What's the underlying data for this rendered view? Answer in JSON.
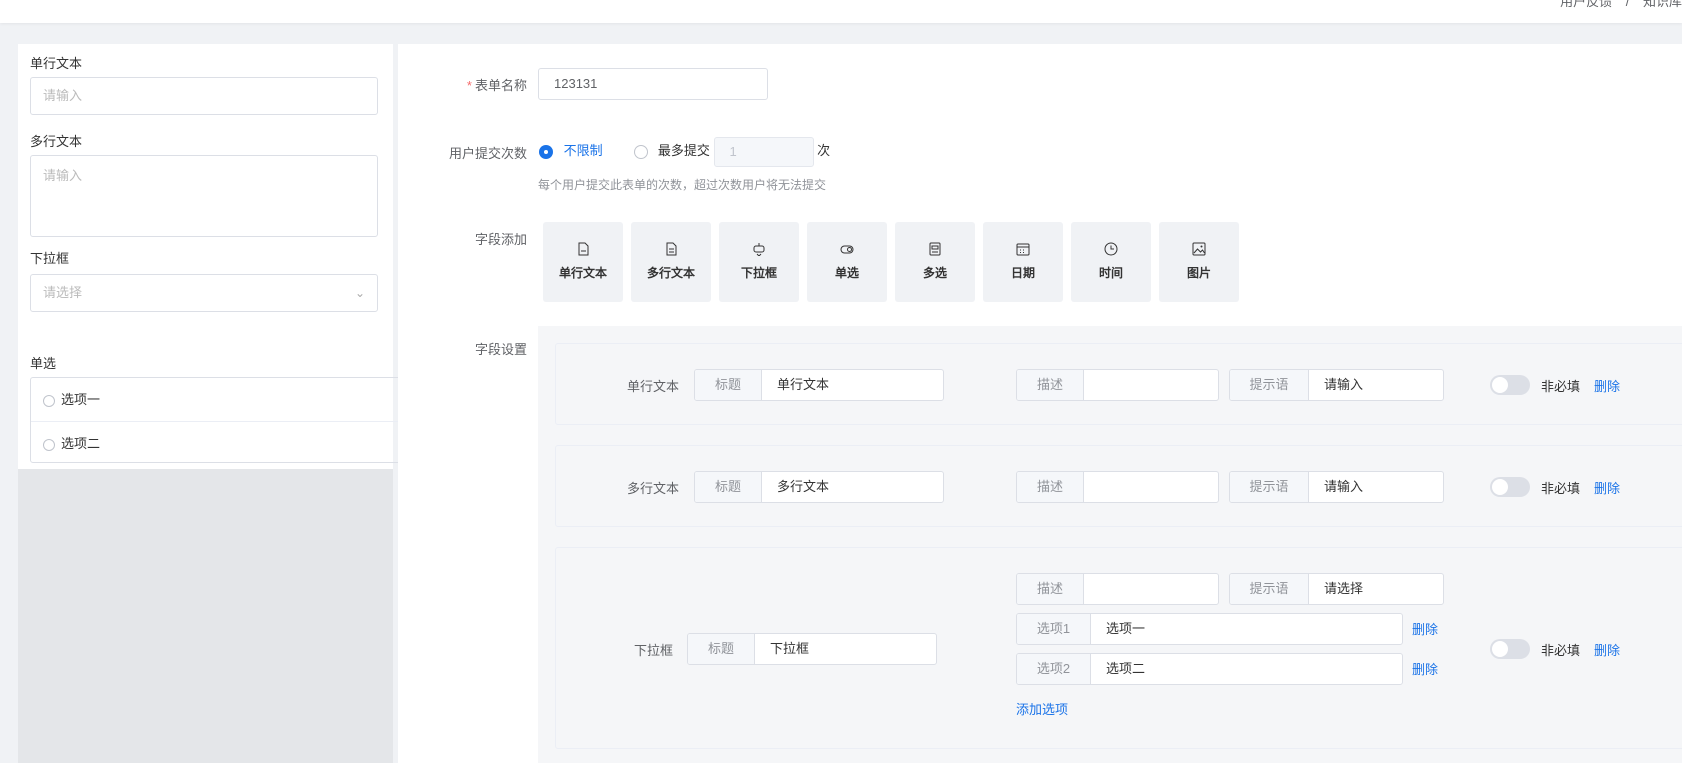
{
  "breadcrumb": [
    "用户反馈",
    "知识库"
  ],
  "preview": {
    "single_label": "单行文本",
    "single_placeholder": "请输入",
    "multi_label": "多行文本",
    "multi_placeholder": "请输入",
    "select_label": "下拉框",
    "select_placeholder": "请选择",
    "radio_label": "单选",
    "radio_options": [
      "选项一",
      "选项二"
    ]
  },
  "form": {
    "name_label": "表单名称",
    "name_value": "123131",
    "submit_label": "用户提交次数",
    "unlimited": "不限制",
    "max_submit": "最多提交",
    "max_value": "1",
    "times_unit": "次",
    "hint": "每个用户提交此表单的次数，超过次数用户将无法提交",
    "add_label": "字段添加",
    "settings_label": "字段设置"
  },
  "field_types": [
    {
      "label": "单行文本",
      "icon": "single-text-icon"
    },
    {
      "label": "多行文本",
      "icon": "multi-text-icon"
    },
    {
      "label": "下拉框",
      "icon": "dropdown-icon"
    },
    {
      "label": "单选",
      "icon": "radio-icon"
    },
    {
      "label": "多选",
      "icon": "checkbox-icon"
    },
    {
      "label": "日期",
      "icon": "calendar-icon"
    },
    {
      "label": "时间",
      "icon": "clock-icon"
    },
    {
      "label": "图片",
      "icon": "image-icon"
    }
  ],
  "labels": {
    "title": "标题",
    "desc": "描述",
    "prompt": "提示语",
    "optional": "非必填",
    "delete": "删除",
    "add_option": "添加选项"
  },
  "fields": [
    {
      "type": "单行文本",
      "title": "单行文本",
      "desc": "",
      "prompt": "请输入"
    },
    {
      "type": "多行文本",
      "title": "多行文本",
      "desc": "",
      "prompt": "请输入"
    },
    {
      "type": "下拉框",
      "title": "下拉框",
      "desc": "",
      "prompt": "请选择",
      "options": [
        {
          "label": "选项1",
          "value": "选项一"
        },
        {
          "label": "选项2",
          "value": "选项二"
        }
      ]
    }
  ]
}
